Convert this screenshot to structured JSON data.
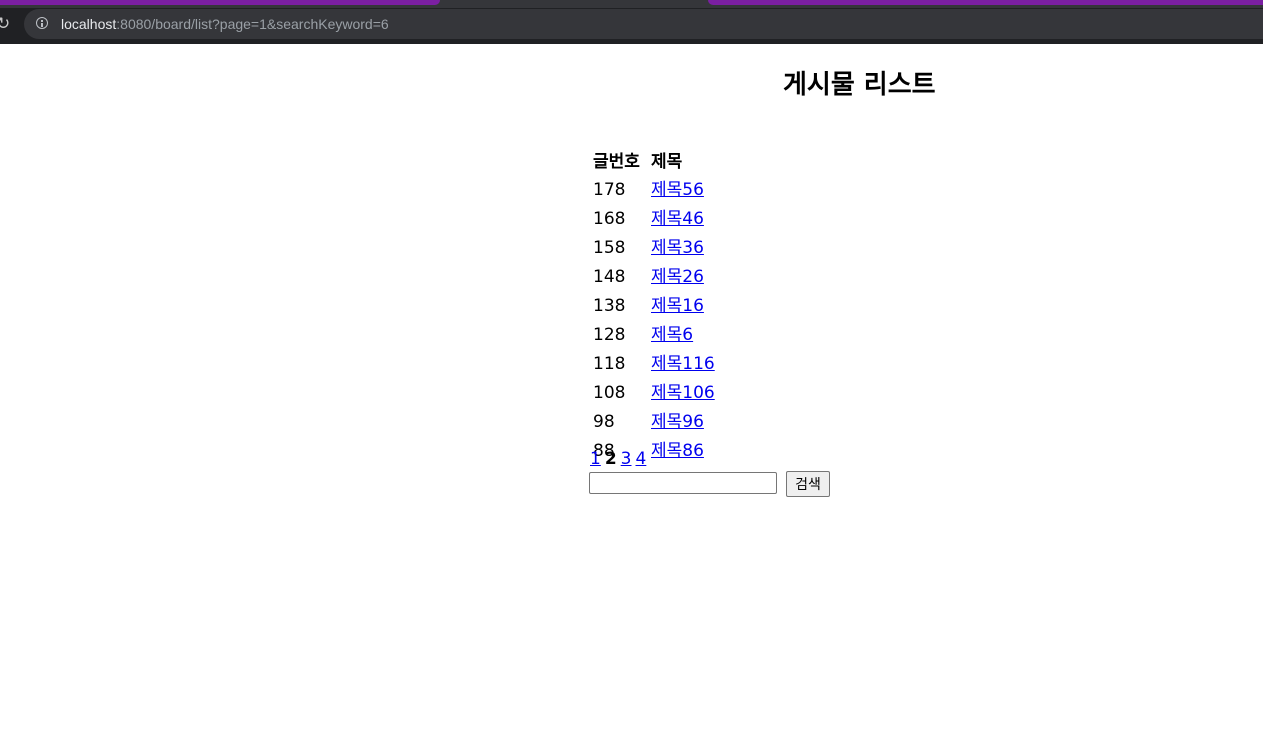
{
  "browser": {
    "url_host": "localhost",
    "url_rest": ":8080/board/list?page=1&searchKeyword=6"
  },
  "page": {
    "title": "게시물 리스트"
  },
  "table": {
    "headers": [
      "글번호",
      "제목"
    ],
    "rows": [
      {
        "id": "178",
        "title": "제목56"
      },
      {
        "id": "168",
        "title": "제목46"
      },
      {
        "id": "158",
        "title": "제목36"
      },
      {
        "id": "148",
        "title": "제목26"
      },
      {
        "id": "138",
        "title": "제목16"
      },
      {
        "id": "128",
        "title": "제목6"
      },
      {
        "id": "118",
        "title": "제목116"
      },
      {
        "id": "108",
        "title": "제목106"
      },
      {
        "id": "98",
        "title": "제목96"
      },
      {
        "id": "88",
        "title": "제목86"
      }
    ]
  },
  "pagination": {
    "pages": [
      "1",
      "2",
      "3",
      "4"
    ],
    "current": "2"
  },
  "search": {
    "value": "",
    "button_label": "검색"
  }
}
